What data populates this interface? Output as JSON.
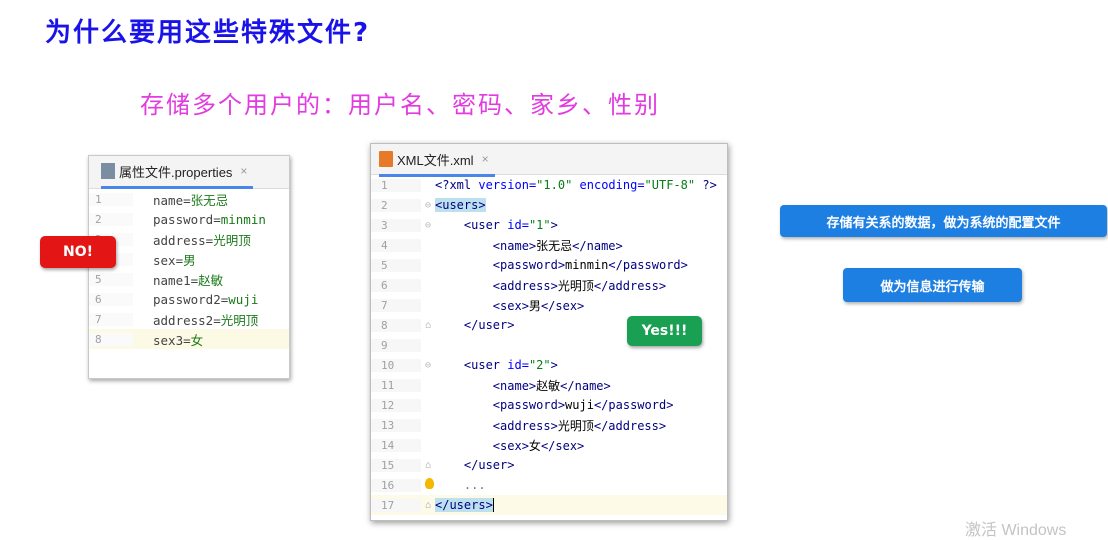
{
  "title": "为什么要用这些特殊文件?",
  "subtitle": "存储多个用户的：用户名、密码、家乡、性别",
  "properties_panel": {
    "tab_label": "属性文件.properties",
    "close_glyph": "×",
    "lines": [
      {
        "num": "1",
        "key": "name=",
        "value": "张无忌"
      },
      {
        "num": "2",
        "key": "password=",
        "value": "minmin"
      },
      {
        "num": "3",
        "key": "address=",
        "value": "光明顶"
      },
      {
        "num": "4",
        "key": "sex=",
        "value": "男"
      },
      {
        "num": "5",
        "key": "name1=",
        "value": "赵敏"
      },
      {
        "num": "6",
        "key": "password2=",
        "value": "wuji"
      },
      {
        "num": "7",
        "key": "address2=",
        "value": "光明顶"
      },
      {
        "num": "8",
        "key": "sex3=",
        "value": "女"
      }
    ]
  },
  "no_badge": "NO!",
  "xml_panel": {
    "tab_label": "XML文件.xml",
    "close_glyph": "×",
    "line_numbers": [
      "1",
      "2",
      "3",
      "4",
      "5",
      "6",
      "7",
      "8",
      "9",
      "10",
      "11",
      "12",
      "13",
      "14",
      "15",
      "16",
      "17"
    ],
    "decl": {
      "open": "<?",
      "name": "xml",
      "attr1": " version=",
      "val1": "\"1.0\"",
      "attr2": " encoding=",
      "val2": "\"UTF-8\"",
      "close": " ?>"
    },
    "users_open": "<users>",
    "users_close": "</users>",
    "user1_open_tag": "<user",
    "user1_id_attr": " id=",
    "user1_id_val": "\"1\"",
    "user2_id_val": "\"2\"",
    "gt": ">",
    "user_close": "</user>",
    "user1": {
      "name": [
        "<name>",
        "张无忌",
        "</name>"
      ],
      "password": [
        "<password>",
        "minmin",
        "</password>"
      ],
      "address": [
        "<address>",
        "光明顶",
        "</address>"
      ],
      "sex": [
        "<sex>",
        "男",
        "</sex>"
      ]
    },
    "user2": {
      "name": [
        "<name>",
        "赵敏",
        "</name>"
      ],
      "password": [
        "<password>",
        "wuji",
        "</password>"
      ],
      "address": [
        "<address>",
        "光明顶",
        "</address>"
      ],
      "sex": [
        "<sex>",
        "女",
        "</sex>"
      ]
    },
    "ellipsis": "..."
  },
  "yes_badge": "Yes!!!",
  "buttons": {
    "store_related": "存储有关系的数据，做为系统的配置文件",
    "transfer": "做为信息进行传输"
  },
  "watermark": "激活 Windows"
}
